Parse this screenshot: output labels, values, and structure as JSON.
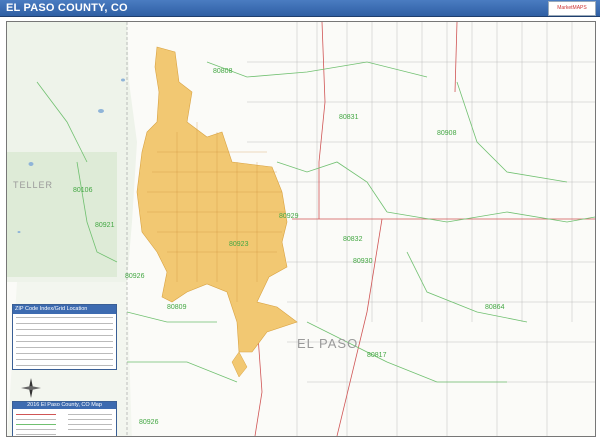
{
  "title": "EL PASO COUNTY, CO",
  "brand_logo": "MarketMAPS",
  "map": {
    "county_labels": [
      "TELLER",
      "EL PASO"
    ],
    "zip_labels": [
      "80808",
      "80831",
      "80908",
      "80106",
      "80921",
      "80929",
      "80923",
      "80832",
      "80930",
      "80864",
      "80926",
      "80809",
      "80817",
      "80926"
    ],
    "colors": {
      "urban": "#f2c872",
      "urban_edge": "#d9a241",
      "zip_boundary": "#70c070",
      "roads": "#a8a8a8",
      "hwy": "#d05555",
      "park": "#d9e8d2",
      "water": "#8fb4d8"
    }
  },
  "zip_index": {
    "title": "ZIP Code Index/Grid Location"
  },
  "legend": {
    "title": "2016 El Paso County, CO Map"
  },
  "icons": [
    "north-arrow-icon"
  ]
}
